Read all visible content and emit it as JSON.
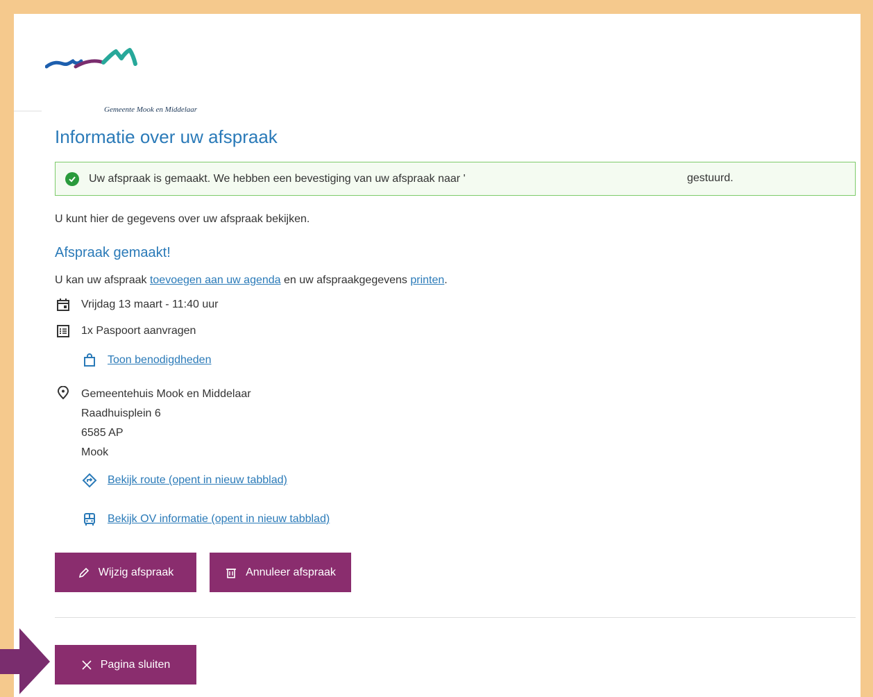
{
  "municipality": {
    "logo_text": "Gemeente Mook en Middelaar"
  },
  "page": {
    "title": "Informatie over uw afspraak"
  },
  "alert": {
    "message_start": "Uw afspraak is gemaakt. We hebben een bevestiging van uw afspraak naar '",
    "message_end": "gestuurd."
  },
  "intro": "U kunt hier de gegevens over uw afspraak bekijken.",
  "confirmation": {
    "heading": "Afspraak gemaakt!",
    "text_part1": "U kan uw afspraak ",
    "link_agenda": "toevoegen aan uw agenda",
    "text_part2": " en uw afspraakgegevens ",
    "link_print": "printen",
    "text_part3": "."
  },
  "appointment": {
    "datetime": "Vrijdag 13 maart - 11:40 uur",
    "product": "1x Paspoort aanvragen",
    "requirements_link": "Toon benodigdheden",
    "location": {
      "name": "Gemeentehuis Mook en Middelaar",
      "street": "Raadhuisplein 6",
      "postcode": "6585 AP",
      "city": "Mook"
    },
    "route_link": "Bekijk route (opent in nieuw tabblad)",
    "ov_link": "Bekijk OV informatie (opent in nieuw tabblad)"
  },
  "actions": {
    "edit_label": "Wijzig afspraak",
    "cancel_label": "Annuleer afspraak",
    "close_label": "Pagina sluiten"
  },
  "colors": {
    "accent": "#8a2d6e",
    "link": "#2a7ab8",
    "success": "#2a9a3c",
    "frame": "#f5c98d"
  }
}
